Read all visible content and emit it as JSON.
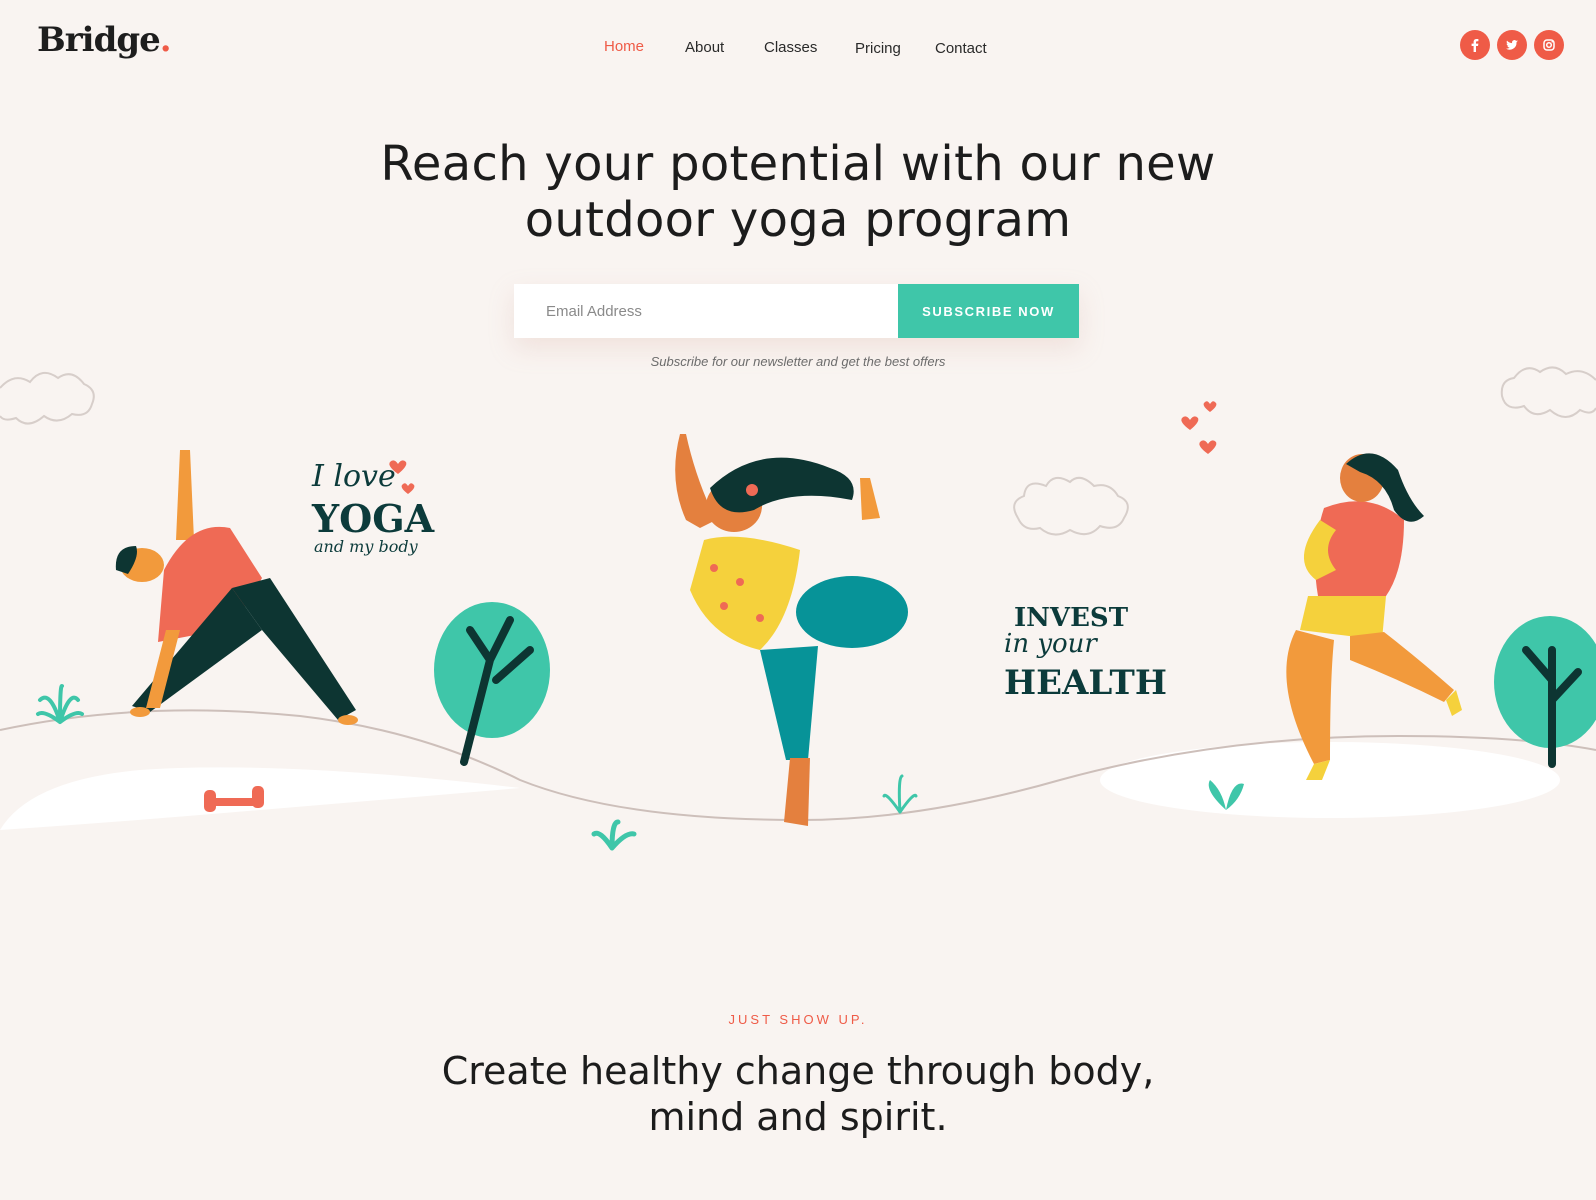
{
  "brand": {
    "name": "Bridge",
    "dot": ".",
    "accent": "#ef5b47"
  },
  "nav": {
    "items": [
      {
        "label": "Home",
        "active": true
      },
      {
        "label": "About"
      },
      {
        "label": "Classes"
      },
      {
        "label": "Pricing"
      },
      {
        "label": "Contact"
      }
    ]
  },
  "socials": [
    {
      "icon": "facebook-icon"
    },
    {
      "icon": "twitter-icon"
    },
    {
      "icon": "instagram-icon"
    }
  ],
  "hero": {
    "title_line1": "Reach your potential with our new",
    "title_line2": "outdoor yoga program",
    "email_placeholder": "Email Address",
    "subscribe_label": "SUBSCRIBE NOW",
    "note": "Subscribe for our newsletter and get the best offers",
    "button_color": "#3fc6a9"
  },
  "illustration": {
    "badge1": {
      "line1": "I love",
      "line2": "YOGA",
      "line3": "and my body"
    },
    "badge2": {
      "line1": "INVEST",
      "line2": "in your",
      "line3": "HEALTH"
    }
  },
  "section": {
    "kicker": "JUST SHOW UP.",
    "title_line1": "Create healthy change through body,",
    "title_line2": "mind and spirit."
  }
}
